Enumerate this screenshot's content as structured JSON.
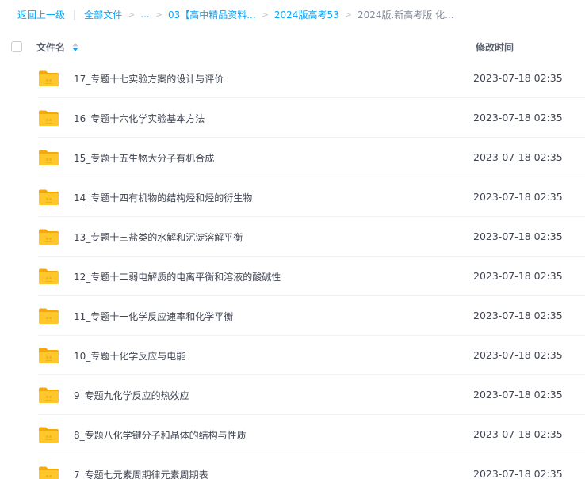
{
  "breadcrumb": {
    "back": "返回上一级",
    "all_files": "全部文件",
    "ellipsis": "...",
    "folder_1": "03【高中精品资料...",
    "folder_2": "2024版高考53",
    "current": "2024版.新高考版 化..."
  },
  "header": {
    "name_label": "文件名",
    "time_label": "修改时间"
  },
  "colors": {
    "accent": "#06a7ff",
    "folder": "#ffc72c",
    "folder_dark": "#f3a80f"
  },
  "files": [
    {
      "name": "17_专题十七实验方案的设计与评价",
      "time": "2023-07-18 02:35",
      "icon": "folder-icon"
    },
    {
      "name": "16_专题十六化学实验基本方法",
      "time": "2023-07-18 02:35",
      "icon": "folder-icon"
    },
    {
      "name": "15_专题十五生物大分子有机合成",
      "time": "2023-07-18 02:35",
      "icon": "folder-icon"
    },
    {
      "name": "14_专题十四有机物的结构烃和烃的衍生物",
      "time": "2023-07-18 02:35",
      "icon": "folder-icon"
    },
    {
      "name": "13_专题十三盐类的水解和沉淀溶解平衡",
      "time": "2023-07-18 02:35",
      "icon": "folder-icon"
    },
    {
      "name": "12_专题十二弱电解质的电离平衡和溶液的酸碱性",
      "time": "2023-07-18 02:35",
      "icon": "folder-icon"
    },
    {
      "name": "11_专题十一化学反应速率和化学平衡",
      "time": "2023-07-18 02:35",
      "icon": "folder-icon"
    },
    {
      "name": "10_专题十化学反应与电能",
      "time": "2023-07-18 02:35",
      "icon": "folder-icon"
    },
    {
      "name": "9_专题九化学反应的热效应",
      "time": "2023-07-18 02:35",
      "icon": "folder-icon"
    },
    {
      "name": "8_专题八化学键分子和晶体的结构与性质",
      "time": "2023-07-18 02:35",
      "icon": "folder-icon"
    },
    {
      "name": "7_专题七元素周期律元素周期表",
      "time": "2023-07-18 02:35",
      "icon": "folder-icon"
    }
  ]
}
